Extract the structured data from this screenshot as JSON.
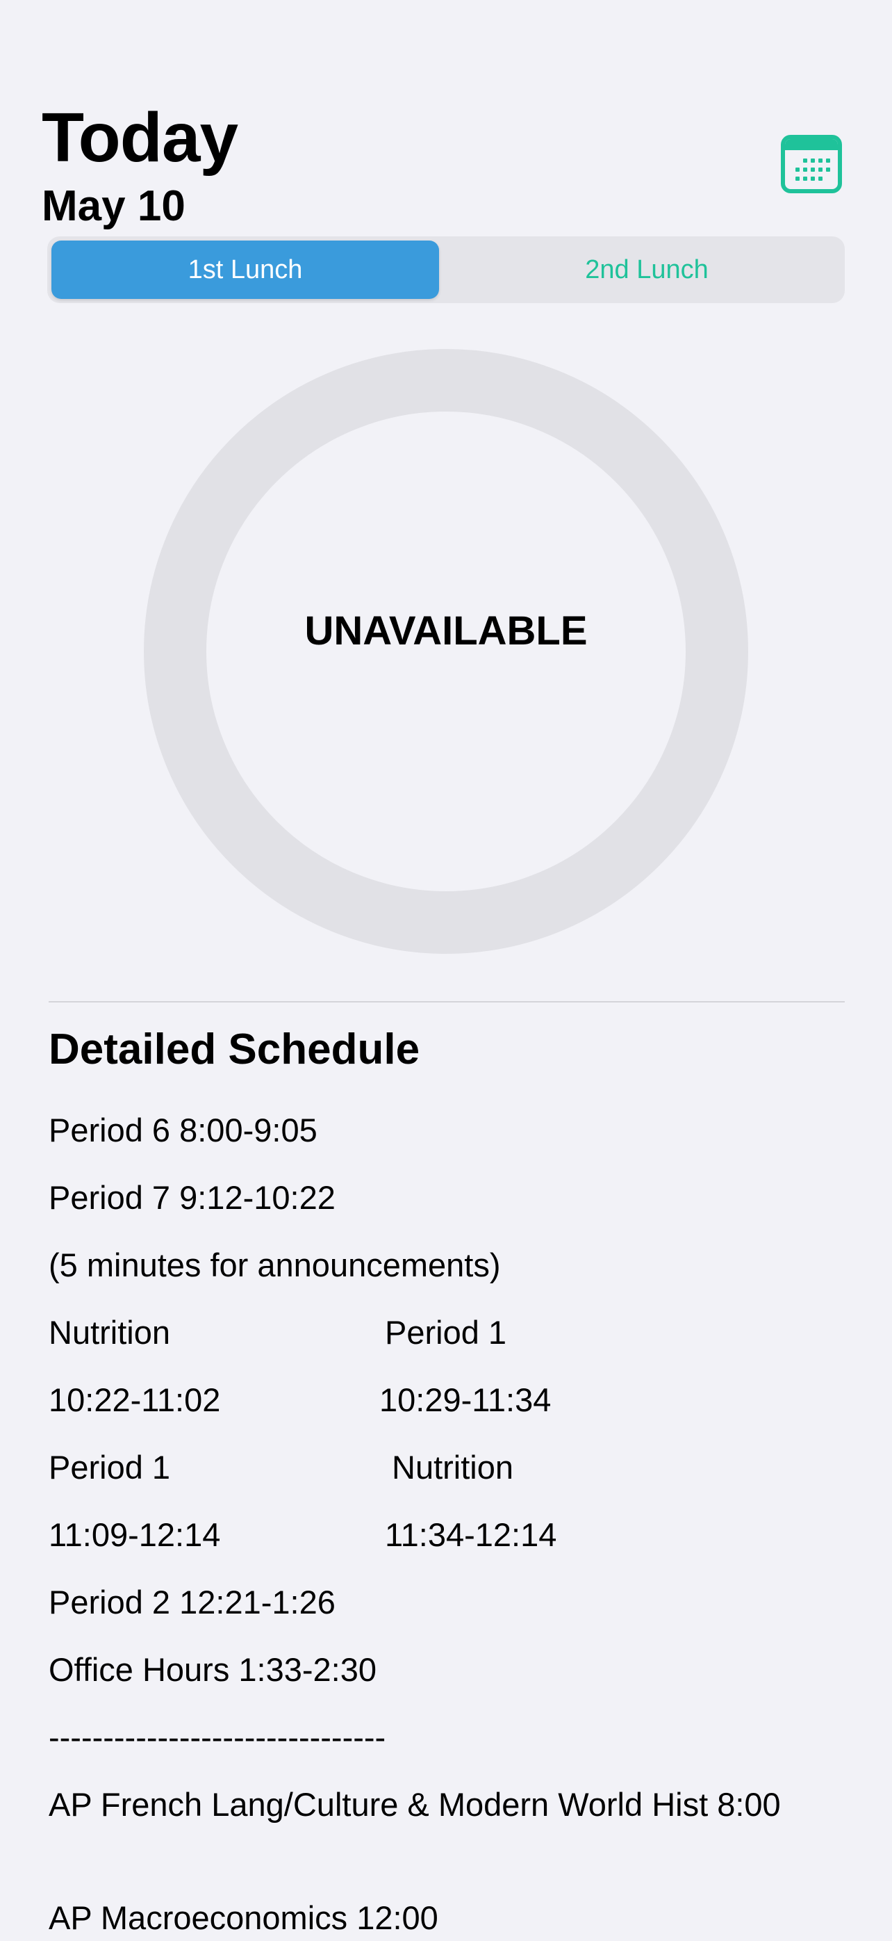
{
  "header": {
    "title": "Today",
    "date": "May 10"
  },
  "calendar_button": {
    "icon": "calendar-icon",
    "color": "#1fc29a"
  },
  "segmented_control": {
    "options": [
      "1st Lunch",
      "2nd Lunch"
    ],
    "selected": "1st Lunch",
    "active_color": "#3a9bdc",
    "inactive_text_color": "#1fc29a"
  },
  "progress_ring": {
    "label": "UNAVAILABLE"
  },
  "schedule": {
    "title": "Detailed Schedule",
    "lines": [
      "Period 6 8:00-9:05",
      "Period 7 9:12-10:22",
      "(5 minutes for announcements)"
    ],
    "lunch_columns": [
      {
        "left": "Nutrition",
        "right": "Period 1"
      },
      {
        "left": "10:22-11:02",
        "right": "10:29-11:34"
      },
      {
        "left": "Period 1",
        "right": "Nutrition"
      },
      {
        "left": "11:09-12:14",
        "right": "11:34-12:14"
      }
    ],
    "after_lines": [
      "Period 2 12:21-1:26",
      "Office Hours 1:33-2:30",
      "-------------------------------"
    ],
    "exams": [
      "AP French Lang/Culture & Modern World Hist 8:00",
      "AP Macroeconomics 12:00"
    ]
  }
}
